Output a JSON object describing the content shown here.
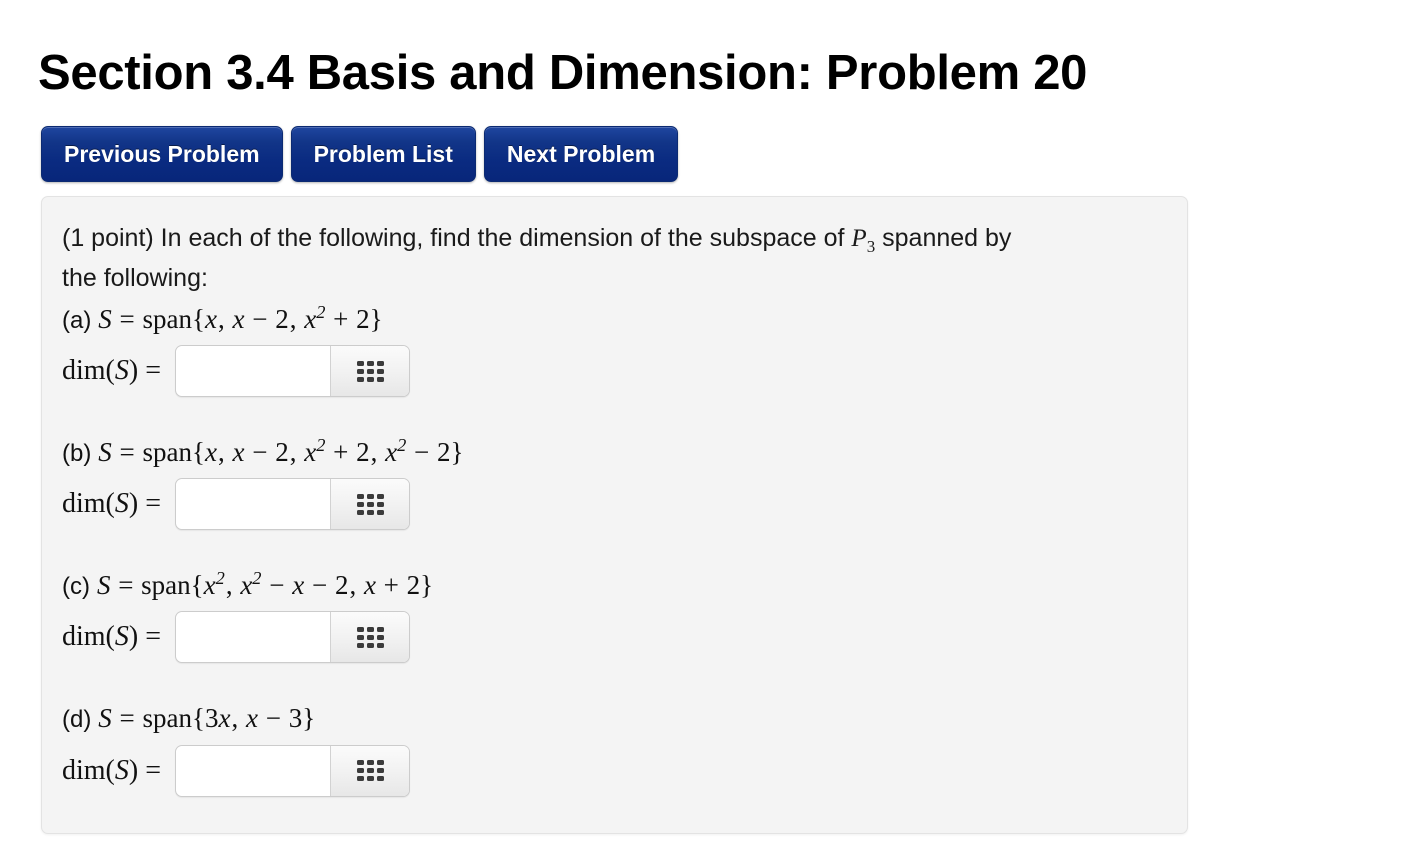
{
  "page": {
    "title": "Section 3.4 Basis and Dimension: Problem 20",
    "background_color": "#ffffff"
  },
  "nav": {
    "buttons": [
      {
        "label": "Previous Problem",
        "name": "previous-problem-button"
      },
      {
        "label": "Problem List",
        "name": "problem-list-button"
      },
      {
        "label": "Next Problem",
        "name": "next-problem-button"
      }
    ],
    "button_color": "#0a2b81",
    "button_text_color": "#ffffff"
  },
  "problem": {
    "points_text": "(1 point)",
    "prompt_before_math": "In each of the following, find the dimension of the subspace of",
    "poly_space": {
      "symbol": "P",
      "subscript": "3"
    },
    "prompt_after_math": "spanned by",
    "prompt_line2": "the following:",
    "panel_background": "#f4f4f4",
    "panel_border_color": "#e3e3e3",
    "parts": [
      {
        "label": "(a)",
        "set_symbol": "S",
        "equals": "=",
        "span_word": "span",
        "open_brace": "{",
        "expression": "x, x − 2, x² + 2",
        "close_brace": "}",
        "answer_label_prefix": "dim(",
        "answer_label_var": "S",
        "answer_label_suffix": ") =",
        "input_value": "",
        "input_placeholder": "",
        "button_icon": "grid-3x3-icon"
      },
      {
        "label": "(b)",
        "set_symbol": "S",
        "equals": "=",
        "span_word": "span",
        "open_brace": "{",
        "expression": "x, x − 2, x² + 2, x² − 2",
        "close_brace": "}",
        "answer_label_prefix": "dim(",
        "answer_label_var": "S",
        "answer_label_suffix": ") =",
        "input_value": "",
        "input_placeholder": "",
        "button_icon": "grid-3x3-icon"
      },
      {
        "label": "(c)",
        "set_symbol": "S",
        "equals": "=",
        "span_word": "span",
        "open_brace": "{",
        "expression": "x², x² − x − 2, x + 2",
        "close_brace": "}",
        "answer_label_prefix": "dim(",
        "answer_label_var": "S",
        "answer_label_suffix": ") =",
        "input_value": "",
        "input_placeholder": "",
        "button_icon": "grid-3x3-icon"
      },
      {
        "label": "(d)",
        "set_symbol": "S",
        "equals": "=",
        "span_word": "span",
        "open_brace": "{",
        "expression": "3x, x − 3",
        "close_brace": "}",
        "answer_label_prefix": "dim(",
        "answer_label_var": "S",
        "answer_label_suffix": ") =",
        "input_value": "",
        "input_placeholder": "",
        "button_icon": "grid-3x3-icon"
      }
    ]
  }
}
